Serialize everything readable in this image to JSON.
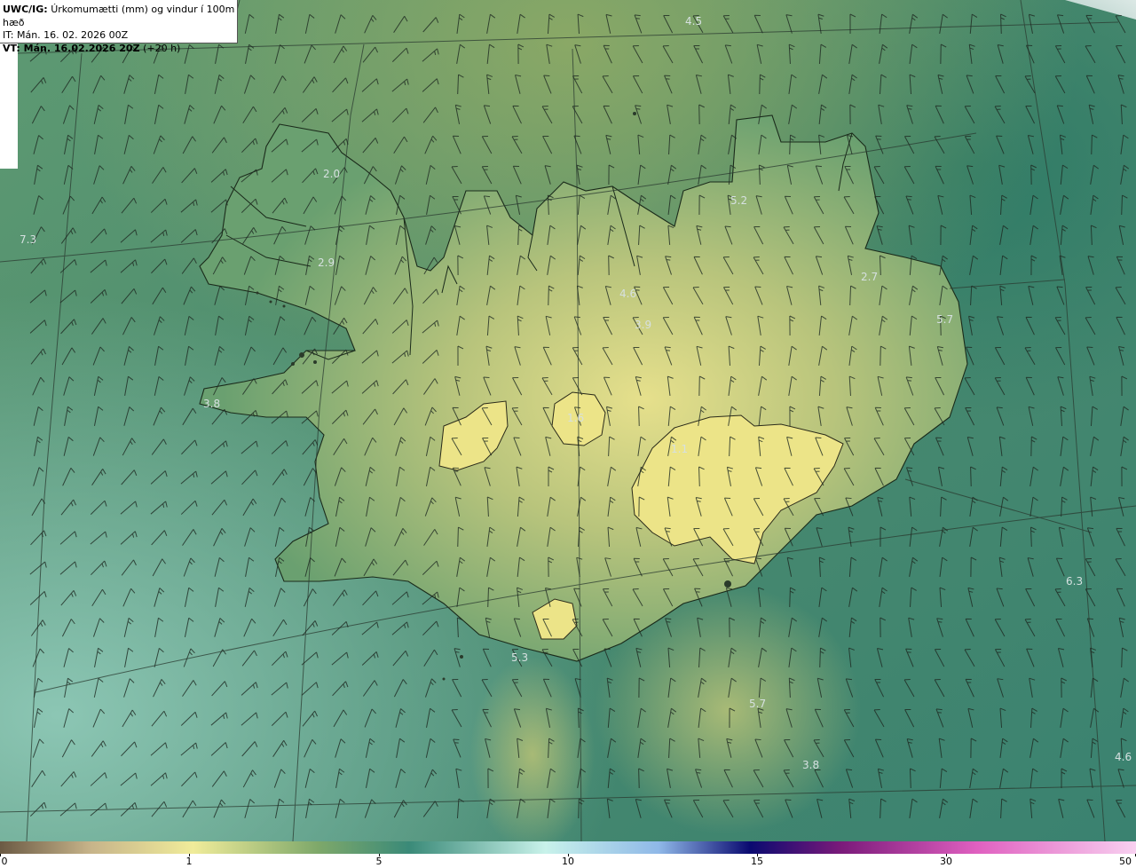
{
  "header": {
    "model": "UWC/IG:",
    "title": "Úrkomumætti (mm) og vindur í 100m hæð",
    "it": "IT: Mán. 16. 02. 2026 00Z",
    "vt_label": "VT: Mán. 16.02.2026 20Z",
    "vt_offset": "(+20 h)"
  },
  "map_values": [
    "4.5",
    "2.0",
    "7.3",
    "2.9",
    "3.8",
    "5.2",
    "4.6",
    "3.9",
    "2.7",
    "5.7",
    "1.6",
    "1.1",
    "6.3",
    "5.3",
    "5.7",
    "3.8",
    "4.6"
  ],
  "colorbar": {
    "labels": [
      "0",
      "1",
      "5",
      "10",
      "15",
      "30",
      "50"
    ],
    "colors": [
      "#6b5a44",
      "#c7b48a",
      "#f0ec9a",
      "#7ea86a",
      "#3a8a78",
      "#c8f2ea",
      "#8fb8e8",
      "#0a0a70",
      "#7a1a7a",
      "#e060c0",
      "#f8d0f0"
    ]
  }
}
